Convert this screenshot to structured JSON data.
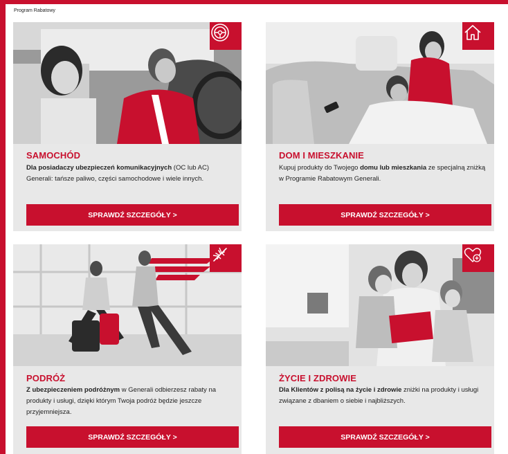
{
  "header": {
    "brand_label": "Program Rabatowy"
  },
  "colors": {
    "accent": "#c8102e",
    "card_bg": "#e8e8e8",
    "page_bg": "#ffffff"
  },
  "cards": [
    {
      "icon": "steering-wheel-icon",
      "title": "SAMOCHÓD",
      "desc_bold": "Dla posiadaczy ubezpieczeń komunikacyjnych",
      "desc_rest": " (OC lub AC) Generali: tańsze paliwo, części samochodowe i wiele innych.",
      "cta": "SPRAWDŹ SZCZEGÓŁY >"
    },
    {
      "icon": "house-icon",
      "title": "DOM I MIESZKANIE",
      "desc_pre": "Kupuj produkty do Twojego ",
      "desc_bold": "domu lub mieszkania",
      "desc_rest": " ze specjalną zniżką w Programie Rabatowym Generali.",
      "cta": "SPRAWDŹ SZCZEGÓŁY >"
    },
    {
      "icon": "airplane-icon",
      "title": "PODRÓŻ",
      "desc_bold": "Z ubezpieczeniem podróżnym",
      "desc_rest": " w Generali odbierzesz rabaty na produkty i usługi, dzięki którym Twoja podróż będzie jeszcze przyjemniejsza.",
      "cta": "SPRAWDŹ SZCZEGÓŁY >"
    },
    {
      "icon": "heart-plus-icon",
      "title": "ŻYCIE I ZDROWIE",
      "desc_bold": "Dla Klientów z polisą na życie i zdrowie",
      "desc_rest": " zniżki na produkty i usługi związane z dbaniem o siebie i najbliższych.",
      "cta": "SPRAWDŹ SZCZEGÓŁY >"
    }
  ]
}
